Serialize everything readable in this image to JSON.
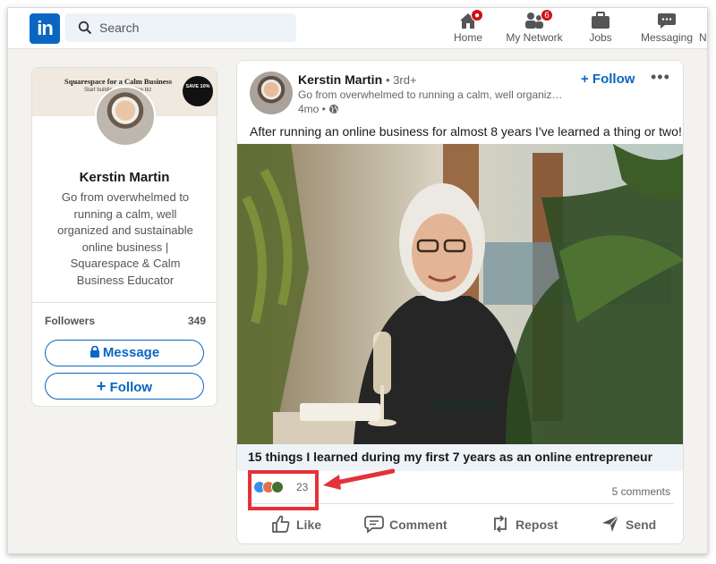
{
  "nav": {
    "search_placeholder": "Search",
    "items": [
      {
        "label": "Home",
        "badge": ""
      },
      {
        "label": "My Network",
        "badge": "6"
      },
      {
        "label": "Jobs",
        "badge": ""
      },
      {
        "label": "Messaging",
        "badge": ""
      }
    ]
  },
  "profile": {
    "banner_text": "Squarespace for a Calm Business",
    "banner_sub": "Start building your online biz",
    "banner_badge": "SAVE 10%",
    "name": "Kerstin Martin",
    "headline": "Go from overwhelmed to running a calm, well organized and sustainable online business | Squarespace & Calm Business Educator",
    "followers_label": "Followers",
    "followers_count": "349",
    "message_label": "Message",
    "follow_label": "Follow"
  },
  "post": {
    "author": "Kerstin Martin",
    "degree": "• 3rd+",
    "headline": "Go from overwhelmed to running a calm, well organized...",
    "time": "4mo •",
    "follow_label": "+ Follow",
    "more": "•••",
    "text": "After running an online business for almost 8 years I've learned a thing or two!",
    "link_title": "15 things I learned during my first 7 years as an online entrepreneur",
    "reaction_count": "23",
    "comments": "5 comments",
    "actions": {
      "like": "Like",
      "comment": "Comment",
      "repost": "Repost",
      "send": "Send"
    }
  },
  "colors": {
    "brand": "#0a66c2",
    "annotation": "#e53138",
    "badge": "#cc1016"
  }
}
